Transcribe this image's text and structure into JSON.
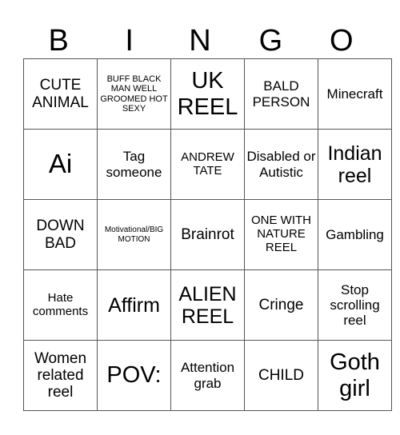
{
  "header": {
    "letters": [
      "B",
      "I",
      "N",
      "G",
      "O"
    ]
  },
  "grid": {
    "rows": [
      [
        {
          "text": "CUTE ANIMAL",
          "size": "lg"
        },
        {
          "text": "BUFF BLACK MAN WELL GROOMED HOT SEXY",
          "size": "sm"
        },
        {
          "text": "UK REEL",
          "size": "xxl"
        },
        {
          "text": "BALD PERSON",
          "size": "ml"
        },
        {
          "text": "Minecraft",
          "size": "ml"
        }
      ],
      [
        {
          "text": "Ai",
          "size": "huge"
        },
        {
          "text": "Tag someone",
          "size": "ml"
        },
        {
          "text": "ANDREW TATE",
          "size": "md"
        },
        {
          "text": "Disabled or Autistic",
          "size": "ml"
        },
        {
          "text": "Indian reel",
          "size": "xl"
        }
      ],
      [
        {
          "text": "DOWN BAD",
          "size": "lg"
        },
        {
          "text": "Motivational/BIG MOTION",
          "size": "xs"
        },
        {
          "text": "Brainrot",
          "size": "lg"
        },
        {
          "text": "ONE WITH NATURE REEL",
          "size": "md"
        },
        {
          "text": "Gambling",
          "size": "ml"
        }
      ],
      [
        {
          "text": "Hate comments",
          "size": "md"
        },
        {
          "text": "Affirm",
          "size": "xl"
        },
        {
          "text": "ALIEN REEL",
          "size": "xl"
        },
        {
          "text": "Cringe",
          "size": "lg"
        },
        {
          "text": "Stop scrolling reel",
          "size": "ml"
        }
      ],
      [
        {
          "text": "Women related reel",
          "size": "lg"
        },
        {
          "text": "POV:",
          "size": "xxl"
        },
        {
          "text": "Attention grab",
          "size": "ml"
        },
        {
          "text": "CHILD",
          "size": "lg"
        },
        {
          "text": "Goth girl",
          "size": "xxl"
        }
      ]
    ]
  }
}
